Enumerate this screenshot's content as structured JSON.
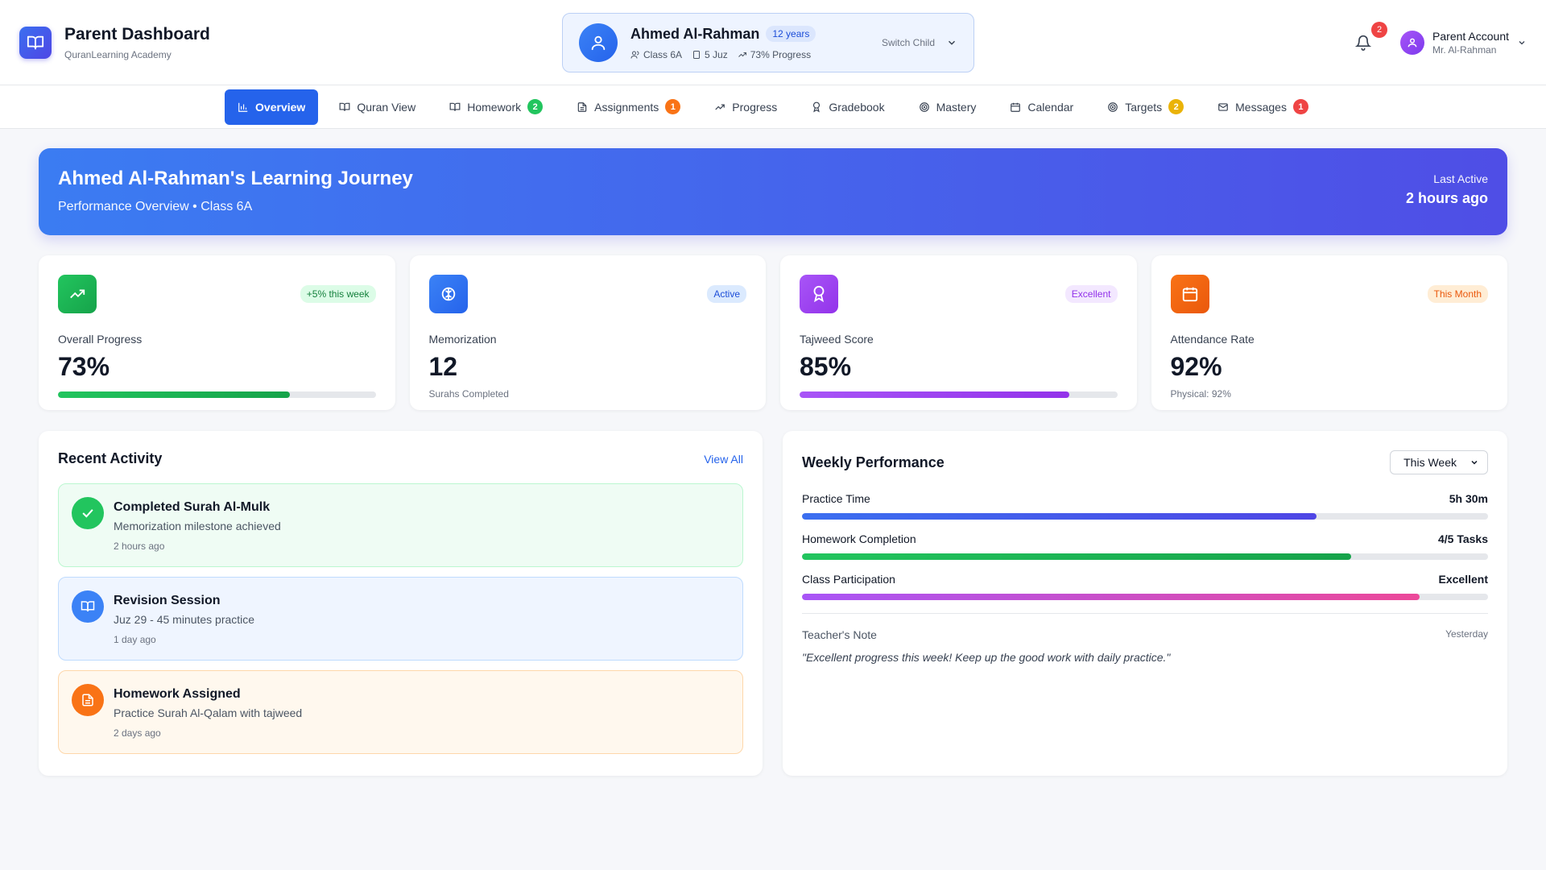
{
  "brand": {
    "title": "Parent Dashboard",
    "subtitle": "QuranLearning Academy"
  },
  "child": {
    "name": "Ahmed Al-Rahman",
    "age": "12 years",
    "class": "Class 6A",
    "juz": "5 Juz",
    "progress": "73% Progress",
    "switch_label": "Switch Child"
  },
  "notifications": {
    "count": "2"
  },
  "account": {
    "name": "Parent Account",
    "sub": "Mr. Al-Rahman"
  },
  "nav": [
    {
      "label": "Overview",
      "icon": "chart-icon",
      "badge": ""
    },
    {
      "label": "Quran View",
      "icon": "book-icon",
      "badge": ""
    },
    {
      "label": "Homework",
      "icon": "book-icon",
      "badge": "2",
      "badge_color": "#22c55e"
    },
    {
      "label": "Assignments",
      "icon": "document-icon",
      "badge": "1",
      "badge_color": "#f97316"
    },
    {
      "label": "Progress",
      "icon": "trend-icon",
      "badge": ""
    },
    {
      "label": "Gradebook",
      "icon": "award-icon",
      "badge": ""
    },
    {
      "label": "Mastery",
      "icon": "target-icon",
      "badge": ""
    },
    {
      "label": "Calendar",
      "icon": "calendar-icon",
      "badge": ""
    },
    {
      "label": "Targets",
      "icon": "target-icon",
      "badge": "2",
      "badge_color": "#eab308"
    },
    {
      "label": "Messages",
      "icon": "mail-icon",
      "badge": "1",
      "badge_color": "#ef4444"
    }
  ],
  "hero": {
    "title": "Ahmed Al-Rahman's Learning Journey",
    "subtitle": "Performance Overview • Class 6A",
    "last_active_label": "Last Active",
    "last_active_value": "2 hours ago"
  },
  "stats": [
    {
      "label": "Overall Progress",
      "value": "73%",
      "tag": "+5% this week",
      "progress": 0.73,
      "foot": ""
    },
    {
      "label": "Memorization",
      "value": "12",
      "tag": "Active",
      "foot": "Surahs Completed"
    },
    {
      "label": "Tajweed Score",
      "value": "85%",
      "tag": "Excellent",
      "progress": 0.85,
      "foot": ""
    },
    {
      "label": "Attendance Rate",
      "value": "92%",
      "tag": "This Month",
      "foot": "Physical: 92%"
    }
  ],
  "activity": {
    "title": "Recent Activity",
    "view_all": "View All",
    "items": [
      {
        "title": "Completed Surah Al-Mulk",
        "desc": "Memorization milestone achieved",
        "time": "2 hours ago"
      },
      {
        "title": "Revision Session",
        "desc": "Juz 29 - 45 minutes practice",
        "time": "1 day ago"
      },
      {
        "title": "Homework Assigned",
        "desc": "Practice Surah Al-Qalam with tajweed",
        "time": "2 days ago"
      }
    ]
  },
  "weekly": {
    "title": "Weekly Performance",
    "period": "This Week",
    "rows": [
      {
        "label": "Practice Time",
        "value": "5h 30m",
        "progress": 0.75
      },
      {
        "label": "Homework Completion",
        "value": "4/5 Tasks",
        "progress": 0.8
      },
      {
        "label": "Class Participation",
        "value": "Excellent",
        "progress": 0.9
      }
    ],
    "note_label": "Teacher's Note",
    "note_date": "Yesterday",
    "note_text": "\"Excellent progress this week! Keep up the good work with daily practice.\""
  }
}
